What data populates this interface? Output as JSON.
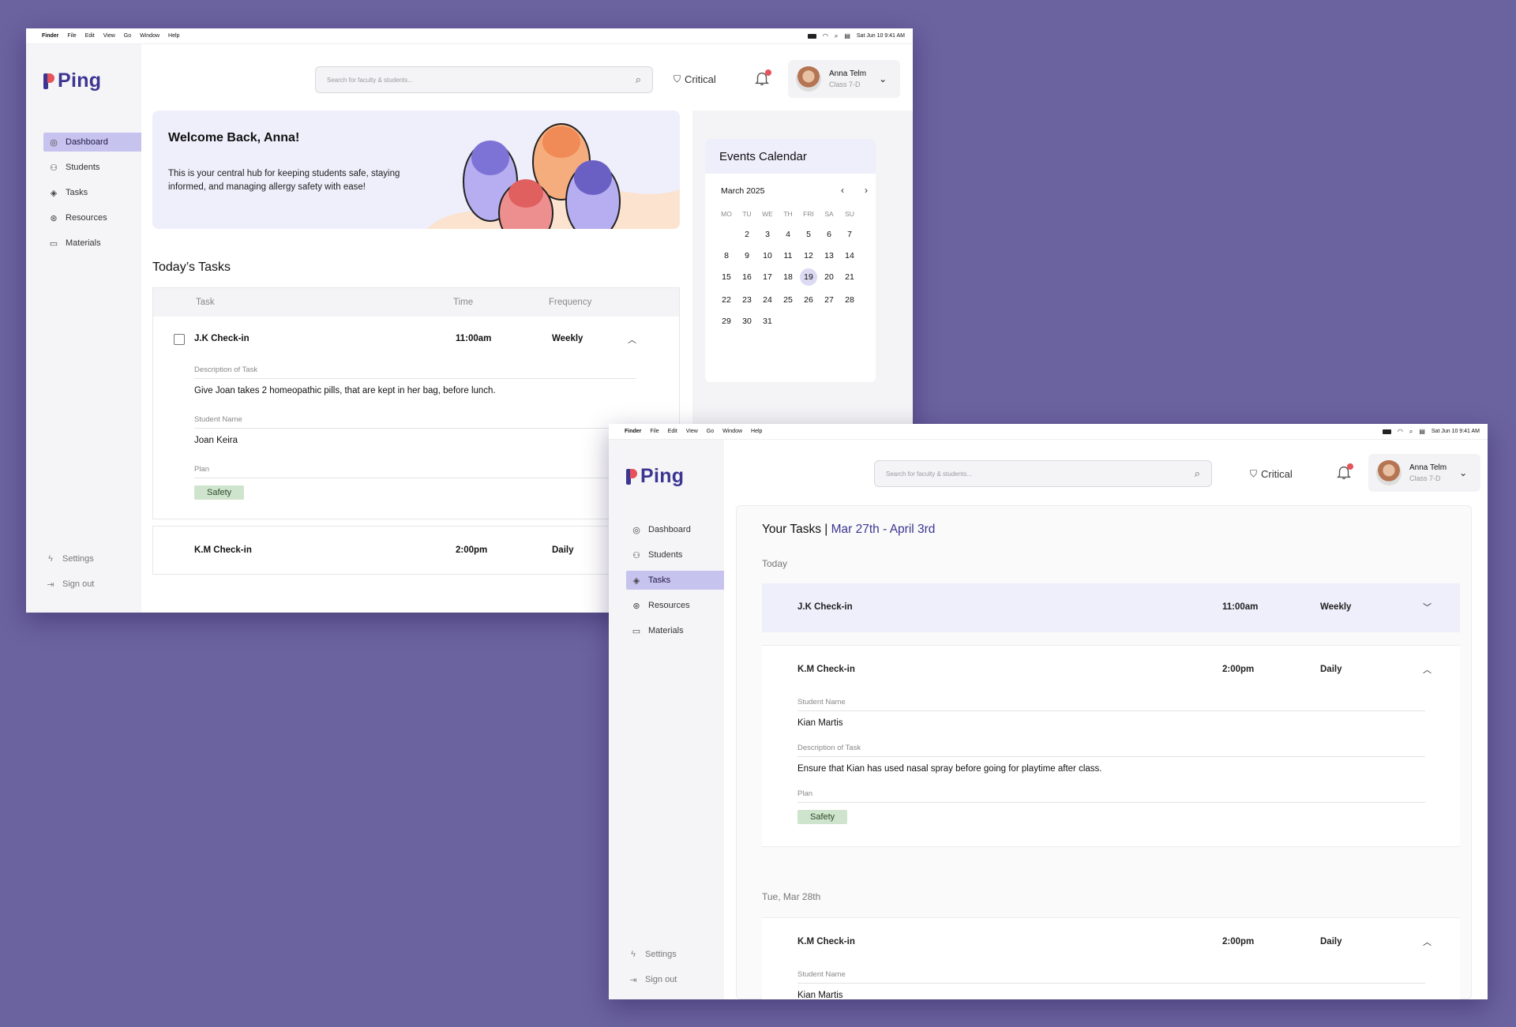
{
  "menubar": {
    "items": [
      "Finder",
      "File",
      "Edit",
      "View",
      "Go",
      "Window",
      "Help"
    ],
    "clock": "Sat Jun 10  9:41 AM"
  },
  "app": {
    "logo_text": "Ping"
  },
  "nav": {
    "items": [
      {
        "label": "Dashboard",
        "icon": "compass-icon"
      },
      {
        "label": "Students",
        "icon": "users-icon"
      },
      {
        "label": "Tasks",
        "icon": "layers-icon"
      },
      {
        "label": "Resources",
        "icon": "resources-icon"
      },
      {
        "label": "Materials",
        "icon": "folder-icon"
      }
    ],
    "settings": "Settings",
    "signout": "Sign out"
  },
  "header": {
    "search_placeholder": "Search for faculty & students...",
    "critical_label": "Critical",
    "user_name": "Anna Telm",
    "user_class": "Class 7-D"
  },
  "dashboard": {
    "welcome_title": "Welcome Back, Anna!",
    "welcome_text": "This is your central hub for keeping students safe, staying informed, and managing allergy safety with ease!",
    "tasks_title": "Today’s Tasks",
    "columns": {
      "task": "Task",
      "time": "Time",
      "frequency": "Frequency"
    },
    "tasks": [
      {
        "name": "J.K Check-in",
        "time": "11:00am",
        "frequency": "Weekly",
        "description_label": "Description of Task",
        "description": "Give Joan takes 2 homeopathic pills, that are kept in her bag, before lunch.",
        "student_label": "Student Name",
        "student": "Joan Keira",
        "plan_label": "Plan",
        "plan": "Safety"
      },
      {
        "name": "K.M Check-in",
        "time": "2:00pm",
        "frequency": "Daily"
      }
    ],
    "events": {
      "title": "Events Calendar",
      "month": "March 2025",
      "dow": [
        "MO",
        "TU",
        "WE",
        "TH",
        "FRI",
        "SA",
        "SU"
      ],
      "weeks": [
        [
          "",
          "2",
          "3",
          "4",
          "5",
          "6",
          "7"
        ],
        [
          "8",
          "9",
          "10",
          "11",
          "12",
          "13",
          "14"
        ],
        [
          "15",
          "16",
          "17",
          "18",
          "19",
          "20",
          "21"
        ],
        [
          "22",
          "23",
          "24",
          "25",
          "26",
          "27",
          "28"
        ],
        [
          "29",
          "30",
          "31",
          "",
          "",
          "",
          ""
        ]
      ],
      "selected": "19"
    }
  },
  "tasks_page": {
    "title": "Your Tasks |",
    "range": " Mar 27th - April 3rd",
    "groups": [
      {
        "label": "Today"
      },
      {
        "label": "Tue, Mar 28th"
      }
    ],
    "today_tasks": [
      {
        "name": "J.K Check-in",
        "time": "11:00am",
        "frequency": "Weekly"
      },
      {
        "name": "K.M Check-in",
        "time": "2:00pm",
        "frequency": "Daily",
        "student_label": "Student Name",
        "student": "Kian Martis",
        "description_label": "Description of Task",
        "description": "Ensure that Kian has used nasal spray before going for playtime after class.",
        "plan_label": "Plan",
        "plan": "Safety"
      }
    ],
    "tue_tasks": [
      {
        "name": "K.M Check-in",
        "time": "2:00pm",
        "frequency": "Daily",
        "student_label": "Student Name",
        "student": "Kian Martis"
      }
    ]
  },
  "colors": {
    "background": "#6b62a0",
    "brand": "#3c3692",
    "accent_red": "#e6535a",
    "nav_active": "#c7c3ef",
    "safety_tag": "#cfe4cc"
  }
}
